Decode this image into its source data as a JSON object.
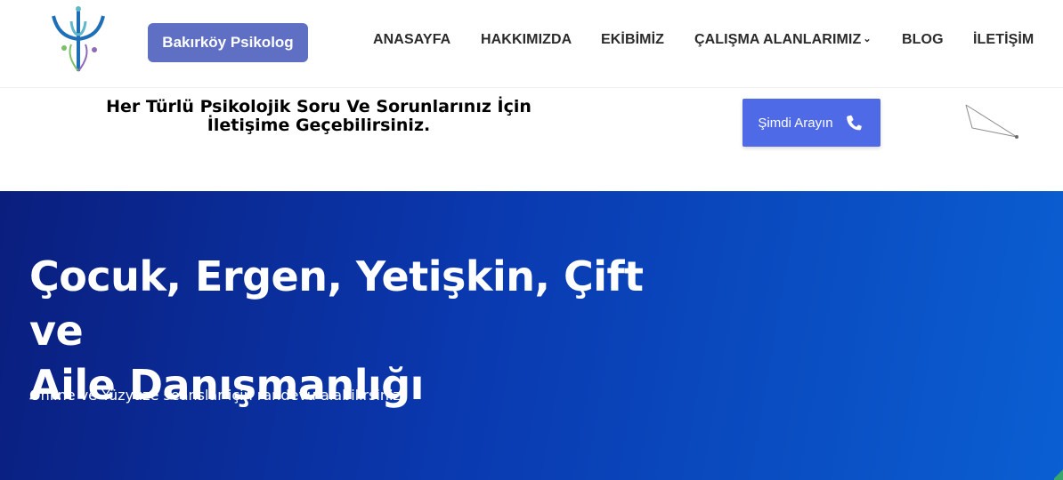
{
  "header": {
    "brand_label": "Bakırköy Psikolog",
    "nav": {
      "home": "ANASAYFA",
      "about": "HAKKIMIZDA",
      "team": "EKİBİMİZ",
      "areas": "ÇALIŞMA ALANLARIMIZ",
      "blog": "BLOG",
      "contact": "İLETİŞİM"
    }
  },
  "banner": {
    "tagline": "Her Türlü Psikolojik Soru Ve Sorunlarınız İçin İletişime Geçebilirsiniz.",
    "call_label": "Şimdi Arayın"
  },
  "hero": {
    "title_line1": "Çocuk, Ergen, Yetişkin, Çift ve",
    "title_line2": "Aile Danışmanlığı",
    "subtitle": "Online ve Yüzyüze seanslar için randevu alabilirsiniz"
  },
  "colors": {
    "brand_button": "#5f6fc4",
    "call_button": "#4f6ae6",
    "hero_start": "#0a1e7e",
    "hero_end": "#0a5fd2"
  }
}
